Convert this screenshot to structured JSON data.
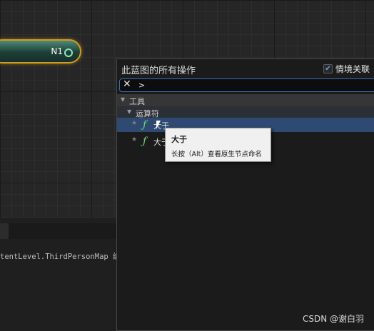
{
  "graph": {
    "node": {
      "label": "N1"
    }
  },
  "output": {
    "log_line": "tentLevel.ThirdPersonMap 编"
  },
  "action_menu": {
    "title": "此蓝图的所有操作",
    "context_sensitive": {
      "label": "情境关联",
      "checked": true
    },
    "search": {
      "value": ">"
    },
    "categories": [
      {
        "label": "工具",
        "subcategories": [
          {
            "label": "运算符",
            "items": [
              {
                "label": "大于",
                "icon": "function-icon",
                "selected": true
              },
              {
                "label": "大于",
                "icon": "function-icon",
                "selected": false
              }
            ]
          }
        ]
      }
    ]
  },
  "tooltip": {
    "title": "大于",
    "body": "长按（Alt）查看原生节点命名"
  },
  "watermark": "CSDN @谢白羽",
  "colors": {
    "node_border": "#d59a1e",
    "selection": "#2e4a73",
    "search_border": "#3c6fb6",
    "checkbox_check": "#4da6ff",
    "function_icon": "#6fd26f"
  }
}
